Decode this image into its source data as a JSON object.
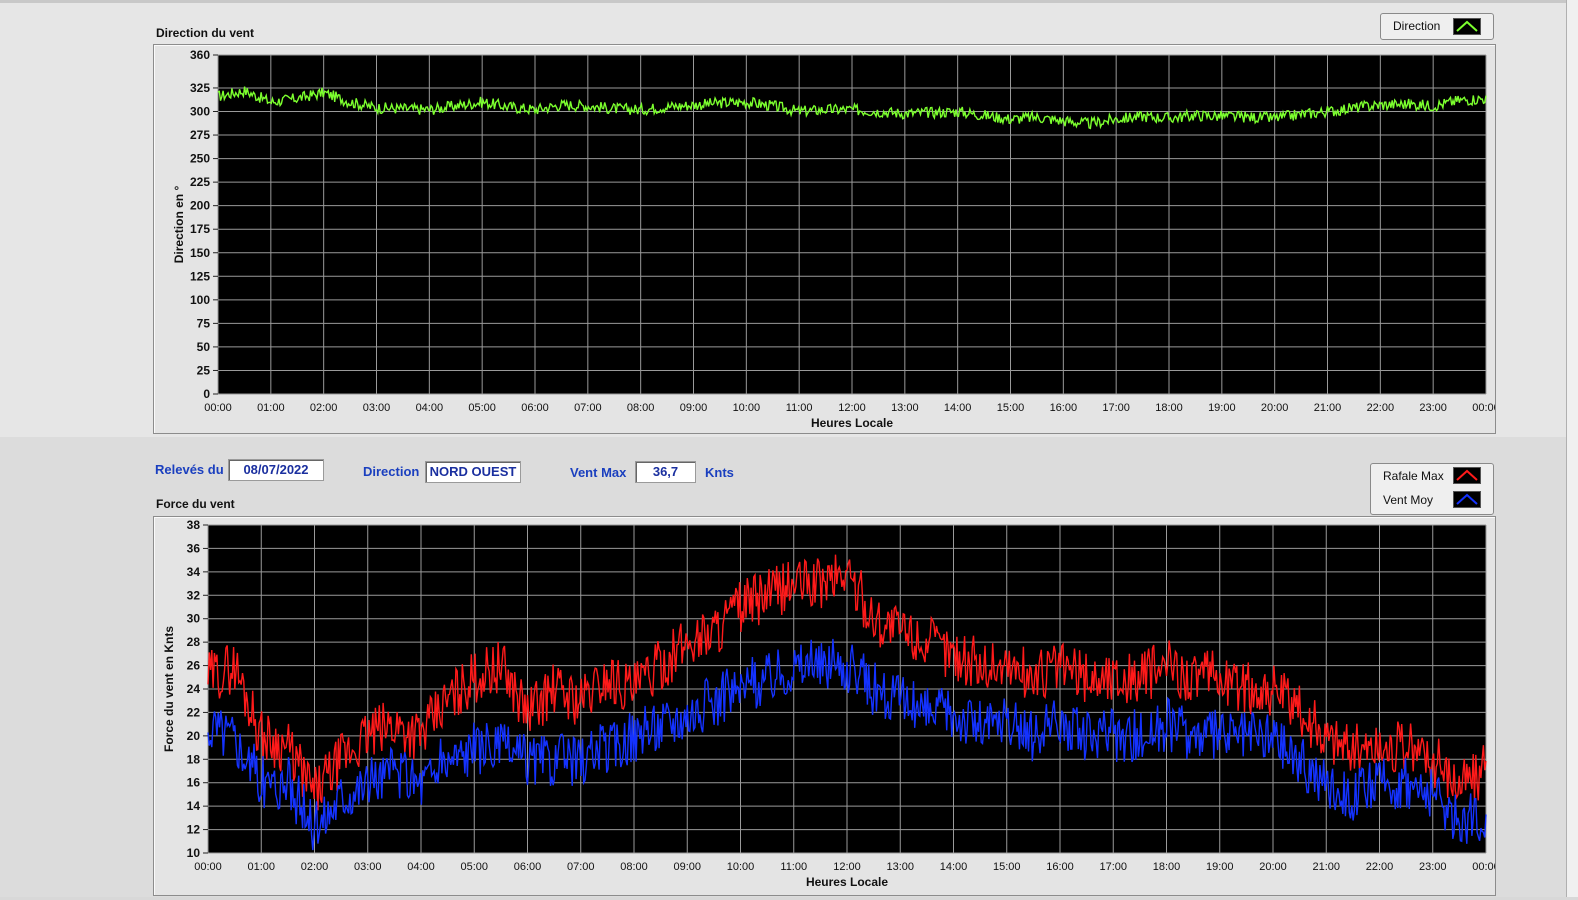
{
  "colors": {
    "direction_line": "#7cff2e",
    "gust_line": "#ff1a1a",
    "avg_line": "#1432ff",
    "plot_bg": "#000000",
    "grid": "#9a9a9a",
    "label_blue": "#1a3fbf"
  },
  "header": {
    "date_label": "Relevés du",
    "date_value": "08/07/2022",
    "direction_label": "Direction",
    "direction_value": "NORD OUEST",
    "max_label": "Vent Max",
    "max_value": "36,7",
    "max_unit": "Knts"
  },
  "chart_data": [
    {
      "type": "line",
      "title": "Direction du vent",
      "xlabel": "Heures Locale",
      "ylabel": "Direction en °",
      "ylim": [
        0,
        360
      ],
      "yticks": [
        "0",
        "25",
        "50",
        "75",
        "100",
        "125",
        "150",
        "175",
        "200",
        "225",
        "250",
        "275",
        "300",
        "325",
        "360"
      ],
      "xticks": [
        "00:00",
        "01:00",
        "02:00",
        "03:00",
        "04:00",
        "05:00",
        "06:00",
        "07:00",
        "08:00",
        "09:00",
        "10:00",
        "11:00",
        "12:00",
        "13:00",
        "14:00",
        "15:00",
        "16:00",
        "17:00",
        "18:00",
        "19:00",
        "20:00",
        "21:00",
        "22:00",
        "23:00",
        "00:00"
      ],
      "grid": true,
      "legend_position": "top-right",
      "series": [
        {
          "name": "Direction",
          "color": "#7cff2e",
          "x_hours": [
            0,
            0.5,
            1,
            1.5,
            2,
            2.5,
            3,
            3.5,
            4,
            4.5,
            5,
            5.5,
            6,
            6.5,
            7,
            7.5,
            8,
            8.5,
            9,
            9.5,
            10,
            10.5,
            11,
            11.5,
            12,
            12.5,
            13,
            13.5,
            14,
            14.5,
            15,
            15.5,
            16,
            16.5,
            17,
            17.5,
            18,
            18.5,
            19,
            19.5,
            20,
            20.5,
            21,
            21.5,
            22,
            22.5,
            23,
            23.5,
            24
          ],
          "values": [
            316,
            322,
            310,
            314,
            320,
            310,
            304,
            303,
            302,
            306,
            310,
            305,
            302,
            307,
            306,
            303,
            302,
            305,
            307,
            309,
            310,
            306,
            300,
            302,
            302,
            300,
            298,
            299,
            300,
            296,
            292,
            294,
            290,
            287,
            292,
            295,
            293,
            296,
            295,
            294,
            293,
            297,
            300,
            304,
            307,
            308,
            306,
            312,
            314
          ]
        }
      ]
    },
    {
      "type": "line",
      "title": "Force du vent",
      "xlabel": "Heures Locale",
      "ylabel": "Force du vent en Knts",
      "ylim": [
        10,
        38
      ],
      "yticks": [
        "10",
        "12",
        "14",
        "16",
        "18",
        "20",
        "22",
        "24",
        "26",
        "28",
        "30",
        "32",
        "34",
        "36",
        "38"
      ],
      "xticks": [
        "00:00",
        "01:00",
        "02:00",
        "03:00",
        "04:00",
        "05:00",
        "06:00",
        "07:00",
        "08:00",
        "09:00",
        "10:00",
        "11:00",
        "12:00",
        "13:00",
        "14:00",
        "15:00",
        "16:00",
        "17:00",
        "18:00",
        "19:00",
        "20:00",
        "21:00",
        "22:00",
        "23:00",
        "00:00"
      ],
      "grid": true,
      "legend_position": "top-right",
      "series": [
        {
          "name": "Rafale Max",
          "color": "#ff1a1a",
          "x_hours": [
            0,
            0.5,
            1,
            1.5,
            2,
            2.5,
            3,
            3.5,
            4,
            4.5,
            5,
            5.5,
            6,
            6.5,
            7,
            7.5,
            8,
            8.5,
            9,
            9.5,
            10,
            10.5,
            11,
            11.5,
            12,
            12.5,
            13,
            13.5,
            14,
            14.5,
            15,
            15.5,
            16,
            16.5,
            17,
            17.5,
            18,
            18.5,
            19,
            19.5,
            20,
            20.5,
            21,
            21.5,
            22,
            22.5,
            23,
            23.5,
            24
          ],
          "values": [
            25,
            26,
            20,
            19,
            15,
            18,
            20,
            21,
            20,
            23,
            25,
            26,
            22,
            24,
            23,
            25,
            24,
            26,
            28,
            29,
            31,
            32,
            33,
            33,
            34,
            30,
            29,
            28,
            27,
            26,
            26,
            25,
            26,
            25,
            25,
            25,
            26,
            25,
            25,
            24,
            24,
            22,
            20,
            19,
            19,
            19,
            18,
            16,
            17
          ]
        },
        {
          "name": "Vent Moy",
          "color": "#1432ff",
          "x_hours": [
            0,
            0.5,
            1,
            1.5,
            2,
            2.5,
            3,
            3.5,
            4,
            4.5,
            5,
            5.5,
            6,
            6.5,
            7,
            7.5,
            8,
            8.5,
            9,
            9.5,
            10,
            10.5,
            11,
            11.5,
            12,
            12.5,
            13,
            13.5,
            14,
            14.5,
            15,
            15.5,
            16,
            16.5,
            17,
            17.5,
            18,
            18.5,
            19,
            19.5,
            20,
            20.5,
            21,
            21.5,
            22,
            22.5,
            23,
            23.5,
            24
          ],
          "values": [
            21,
            20,
            16,
            16,
            12,
            15,
            16,
            17,
            16,
            18,
            19,
            19,
            18,
            18,
            18,
            19,
            20,
            21,
            22,
            23,
            24,
            25,
            26,
            26,
            26,
            24,
            23,
            22,
            22,
            21,
            21,
            20,
            21,
            20,
            20,
            20,
            21,
            20,
            20,
            20,
            20,
            18,
            16,
            15,
            16,
            16,
            15,
            13,
            13
          ]
        }
      ]
    }
  ]
}
